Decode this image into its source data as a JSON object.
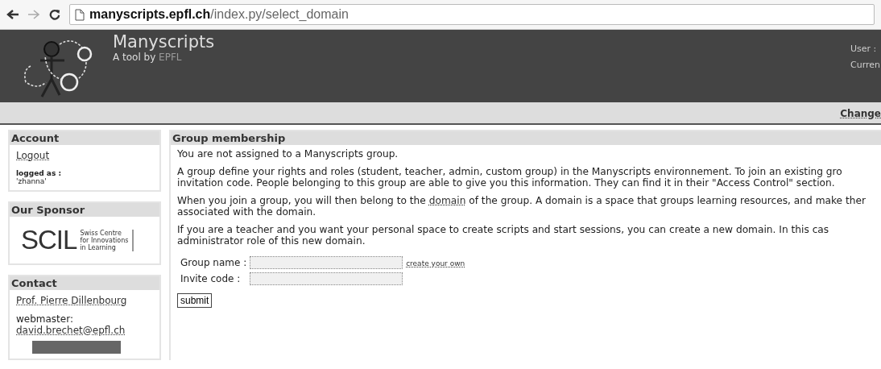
{
  "browser": {
    "url_host": "manyscripts.epfl.ch",
    "url_path": "/index.py/select_domain"
  },
  "header": {
    "title": "Manyscripts",
    "subtitle": "A tool by",
    "subtitle_brand": "EPFL",
    "user_lines": [
      "User :",
      "Curren"
    ]
  },
  "nav_bar": {
    "link": "Change"
  },
  "sidebar": {
    "account": {
      "title": "Account",
      "logout": "Logout",
      "logged_label": "logged as :",
      "username": "'zhanna'"
    },
    "sponsor": {
      "title": "Our Sponsor",
      "logo_mark": "SCIL",
      "logo_lines": [
        "Swiss Centre",
        "for Innovations",
        "in Learning"
      ]
    },
    "contact": {
      "title": "Contact",
      "person": "Prof. Pierre Dillenbourg",
      "webmaster_label": "webmaster:",
      "webmaster_email": "david.brechet@epfl.ch"
    }
  },
  "main": {
    "title": "Group membership",
    "paragraphs": [
      {
        "lines": [
          "You are not assigned to a Manyscripts group."
        ]
      },
      {
        "lines": [
          "A group define your rights and roles (student, teacher, admin, custom group) in the Manyscripts environnement. To join an existing gro",
          "invitation code. People belonging to this group are able to give you this information. They can find it in their \"Access Control\" section."
        ]
      },
      {
        "lines": [
          {
            "before": "When you join a group, you will then belong to the ",
            "link": "domain",
            "after": " of the group. A domain is a space that groups learning resources, and make ther"
          },
          "associated with the domain."
        ]
      },
      {
        "lines": [
          "If you are a teacher and you want your personal space to create scripts and start sessions, you can create a new domain. In this cas",
          "administrator role of this new domain."
        ]
      }
    ],
    "form": {
      "fields": [
        {
          "label": "Group name :"
        },
        {
          "label": "Invite code :"
        }
      ],
      "create_link": "create your own",
      "submit": "submit"
    }
  }
}
